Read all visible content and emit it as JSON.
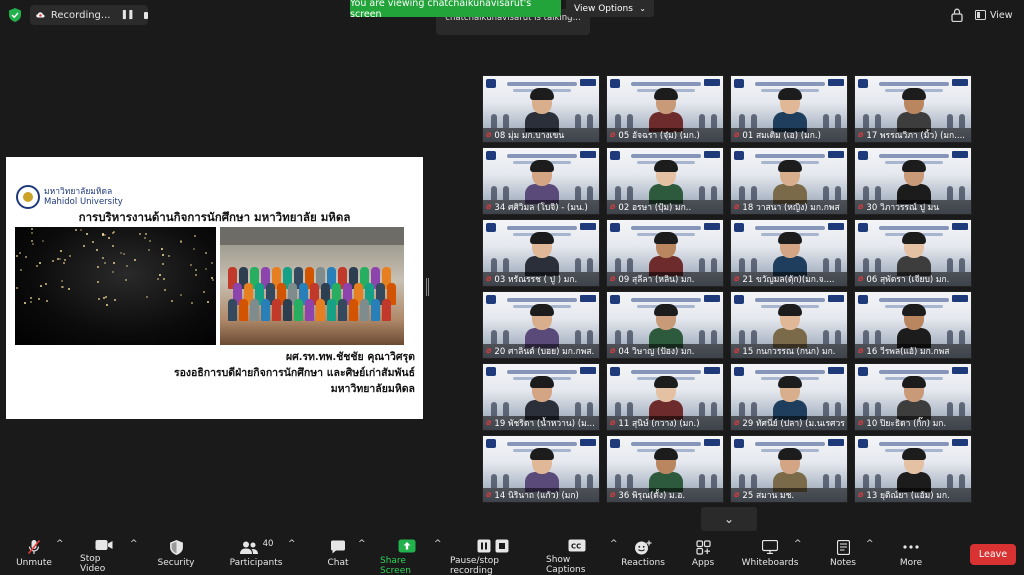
{
  "topbar": {
    "recording_label": "Recording...",
    "viewing_banner": "You are viewing chatchaikunavisarut's screen",
    "view_options_label": "View Options",
    "talking_text": "chatchaikunavisarut is talking...",
    "view_label": "View"
  },
  "slide": {
    "logo_thai": "มหาวิทยาลัยมหิดล",
    "logo_en": "Mahidol University",
    "title": "การบริหารงานด้านกิจการนักศึกษา มหาวิทยาลัย มหิดล",
    "name_line1": "ผศ.รท.ทพ.ชัชชัย คุณาวิศรุต",
    "name_line2": "รองอธิการบดีฝ่ายกิจการนักศึกษา และศิษย์เก่าสัมพันธ์",
    "name_line3": "มหาวิทยาลัยมหิดล"
  },
  "participants": [
    {
      "name": "08 มุ่ม มก.บางเขน"
    },
    {
      "name": "05 อัจฉรา (จุ๋ม) (มก.)"
    },
    {
      "name": "01 สมเดิม (เอ) (มก.)"
    },
    {
      "name": "17 พรรณวิภา (มิ้ว) (มก...."
    },
    {
      "name": "34 ศศิวิมล (โบจิ) - (มน.)"
    },
    {
      "name": "02 อรษา (ปุ้ม) มก.."
    },
    {
      "name": "18 วาสนา (หญิง) มก.กพส"
    },
    {
      "name": "30 วิภาวรรณ์ ปู มน"
    },
    {
      "name": "03 หรัณรรช ( ปู ) มก."
    },
    {
      "name": "09 สุลีลา (หลิน) มก."
    },
    {
      "name": "21 ขวัญมล(ตุ้ก)(มก.จ...."
    },
    {
      "name": "06 สุพัตรา (เจียบ) มก."
    },
    {
      "name": "20 ศาลินต์ (บอย) มก.กพส."
    },
    {
      "name": "04 วิษาญ (ป้อง) มก."
    },
    {
      "name": "15 กนกวรรณ (กนก) มก."
    },
    {
      "name": "16 วีรพล(แอ้) มก.กพส"
    },
    {
      "name": "19 พัชริดา (น้ำหวาน) (ม..."
    },
    {
      "name": "11 สุนิษ์ (กวาง) (มก.)"
    },
    {
      "name": "29 ทัศนีย์ (ปลา) (ม.นเรศวร"
    },
    {
      "name": "10 ปิยะธิดา (กิ๊ก) มก."
    },
    {
      "name": "14 นิรินาถ (แก้ว) (มก)"
    },
    {
      "name": "36 พิรุณ(ตั้ง) ม.อ."
    },
    {
      "name": "25 สมาน มช."
    },
    {
      "name": "13 ยุติณ์ยา (แอ้ม) มก."
    }
  ],
  "toolbar": {
    "unmute": "Unmute",
    "stop_video": "Stop Video",
    "security": "Security",
    "participants": "Participants",
    "participants_count": "40",
    "chat": "Chat",
    "share_screen": "Share Screen",
    "pause_recording": "Pause/stop recording",
    "show_captions": "Show Captions",
    "reactions": "Reactions",
    "apps": "Apps",
    "whiteboards": "Whiteboards",
    "notes": "Notes",
    "more": "More",
    "leave": "Leave"
  },
  "colors": {
    "banner_green": "#22a43a",
    "leave_red": "#d93232",
    "muted_red": "#e63b3b"
  }
}
